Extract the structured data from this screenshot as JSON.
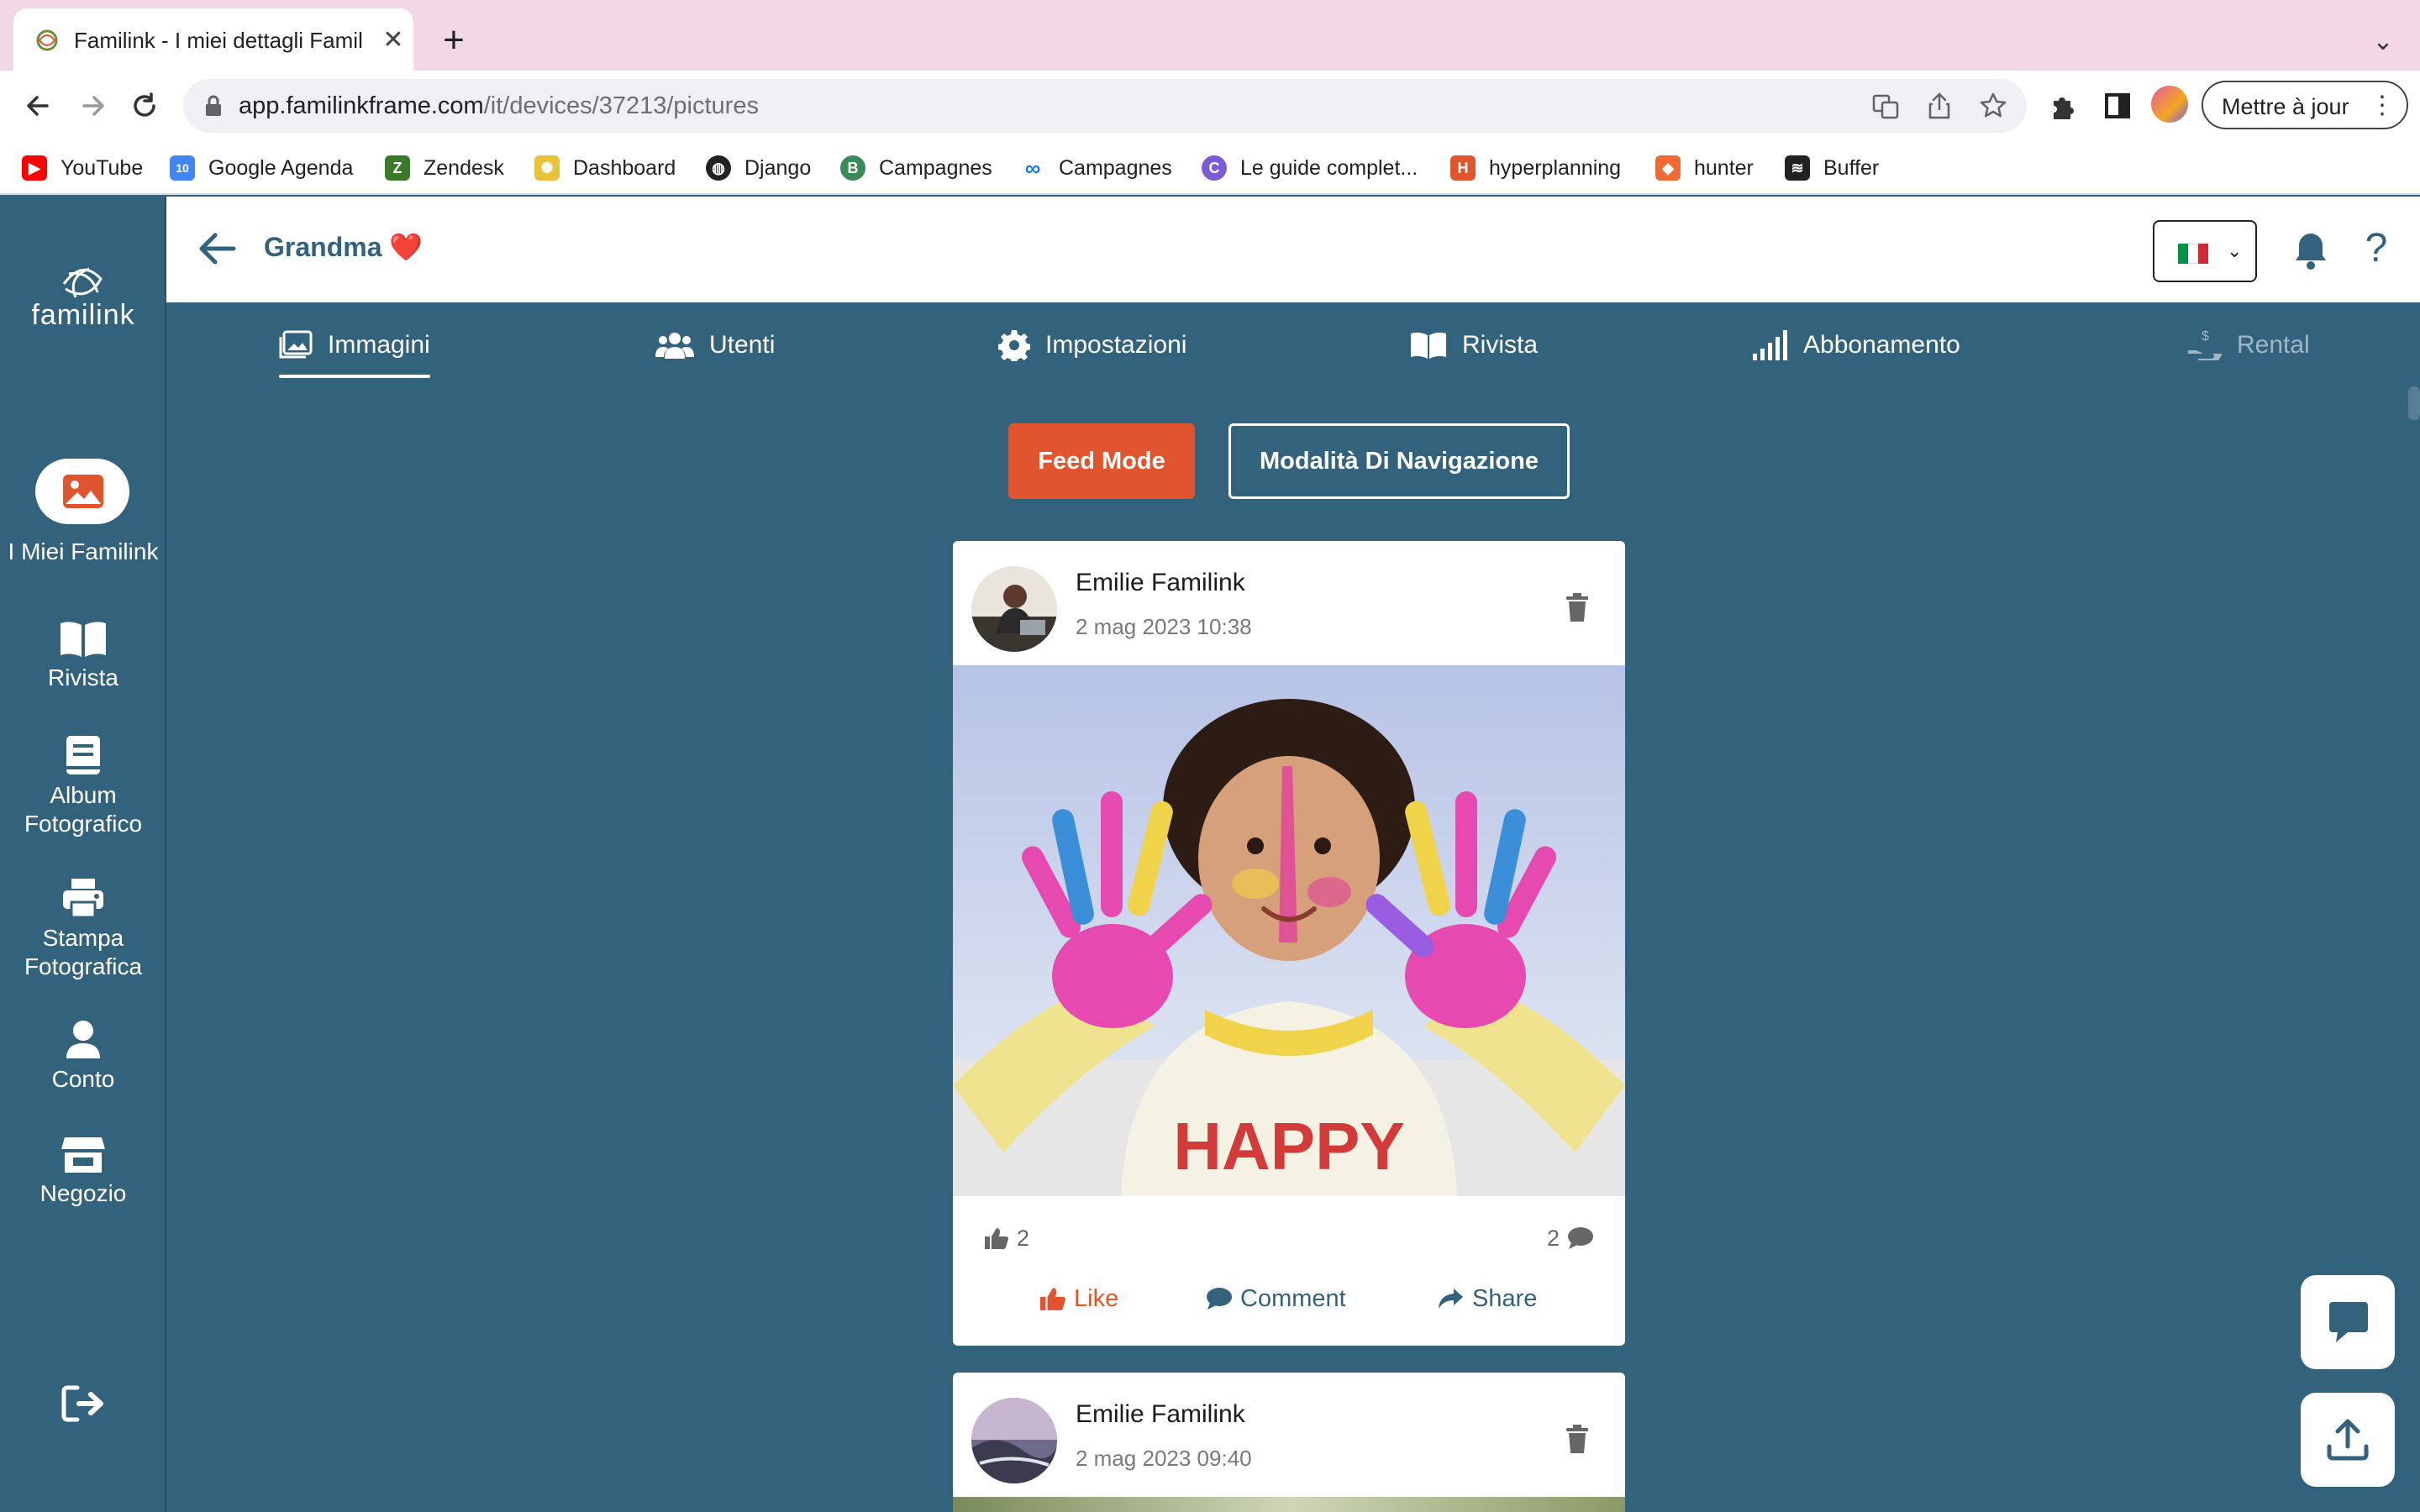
{
  "browser": {
    "tab_title": "Familink - I miei dettagli Famil",
    "tab_close": "✕",
    "new_tab": "+",
    "tab_menu": "⌄",
    "url_host": "app.familinkframe.com",
    "url_path": "/it/devices/37213/pictures",
    "update_label": "Mettre à jour",
    "bookmarks": [
      {
        "label": "YouTube",
        "icon": "youtube-icon",
        "color": "#ff0000"
      },
      {
        "label": "Google Agenda",
        "icon": "calendar-icon",
        "color": "#4285f4"
      },
      {
        "label": "Zendesk",
        "icon": "zendesk-icon",
        "color": "#3b7a2a"
      },
      {
        "label": "Dashboard",
        "icon": "dashboard-icon",
        "color": "#e8c33a"
      },
      {
        "label": "Django",
        "icon": "globe-icon",
        "color": "#222222"
      },
      {
        "label": "Campagnes",
        "icon": "b-icon",
        "color": "#3a8a5a"
      },
      {
        "label": "Campagnes",
        "icon": "meta-icon",
        "color": "#1877f2"
      },
      {
        "label": "Le guide complet...",
        "icon": "c-icon",
        "color": "#7b5cd6"
      },
      {
        "label": "hyperplanning",
        "icon": "h-icon",
        "color": "#e0552e"
      },
      {
        "label": "hunter",
        "icon": "fox-icon",
        "color": "#f06a35"
      },
      {
        "label": "Buffer",
        "icon": "stack-icon",
        "color": "#222222"
      }
    ]
  },
  "brand": {
    "name": "familink"
  },
  "rail": {
    "items": [
      {
        "label": "I Miei Familink",
        "icon": "image-icon"
      },
      {
        "label": "Rivista",
        "icon": "book-icon"
      },
      {
        "label": "Album Fotografico",
        "icon": "album-icon"
      },
      {
        "label": "Stampa Fotografica",
        "icon": "printer-icon"
      },
      {
        "label": "Conto",
        "icon": "user-icon"
      },
      {
        "label": "Negozio",
        "icon": "store-icon"
      }
    ],
    "logout_icon": "logout-icon"
  },
  "header": {
    "title": "Grandma ❤️",
    "language": "it",
    "flag_colors": [
      "#009246",
      "#ffffff",
      "#ce2b37"
    ]
  },
  "tabs": [
    {
      "label": "Immagini",
      "icon": "images-icon",
      "active": true
    },
    {
      "label": "Utenti",
      "icon": "users-icon",
      "active": false
    },
    {
      "label": "Impostazioni",
      "icon": "gear-icon",
      "active": false
    },
    {
      "label": "Rivista",
      "icon": "book-open-icon",
      "active": false
    },
    {
      "label": "Abbonamento",
      "icon": "signal-icon",
      "active": false
    },
    {
      "label": "Rental",
      "icon": "hand-coin-icon",
      "active": false,
      "disabled": true
    }
  ],
  "modes": {
    "feed": "Feed Mode",
    "browse": "Modalità Di Navigazione"
  },
  "posts": [
    {
      "author": "Emilie Familink",
      "date": "2 mag 2023 10:38",
      "likes": "2",
      "comments": "2",
      "actions": {
        "like": "Like",
        "comment": "Comment",
        "share": "Share"
      }
    },
    {
      "author": "Emilie Familink",
      "date": "2 mag 2023 09:40"
    }
  ],
  "colors": {
    "primary": "#33627c",
    "accent": "#e0552e",
    "tab_bar_bg": "#f2d7e6"
  }
}
